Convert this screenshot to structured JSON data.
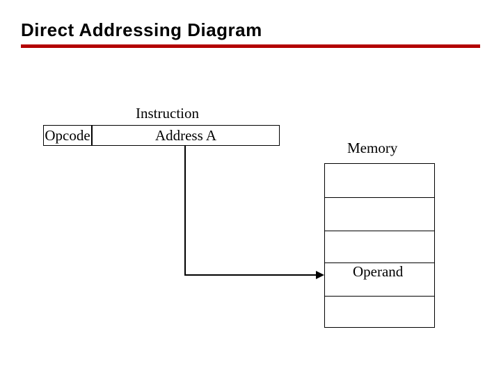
{
  "title": "Direct Addressing Diagram",
  "instruction_label": "Instruction",
  "opcode_label": "Opcode",
  "address_label": "Address A",
  "memory_label": "Memory",
  "operand_label": "Operand",
  "colors": {
    "rule": "#b30000"
  }
}
